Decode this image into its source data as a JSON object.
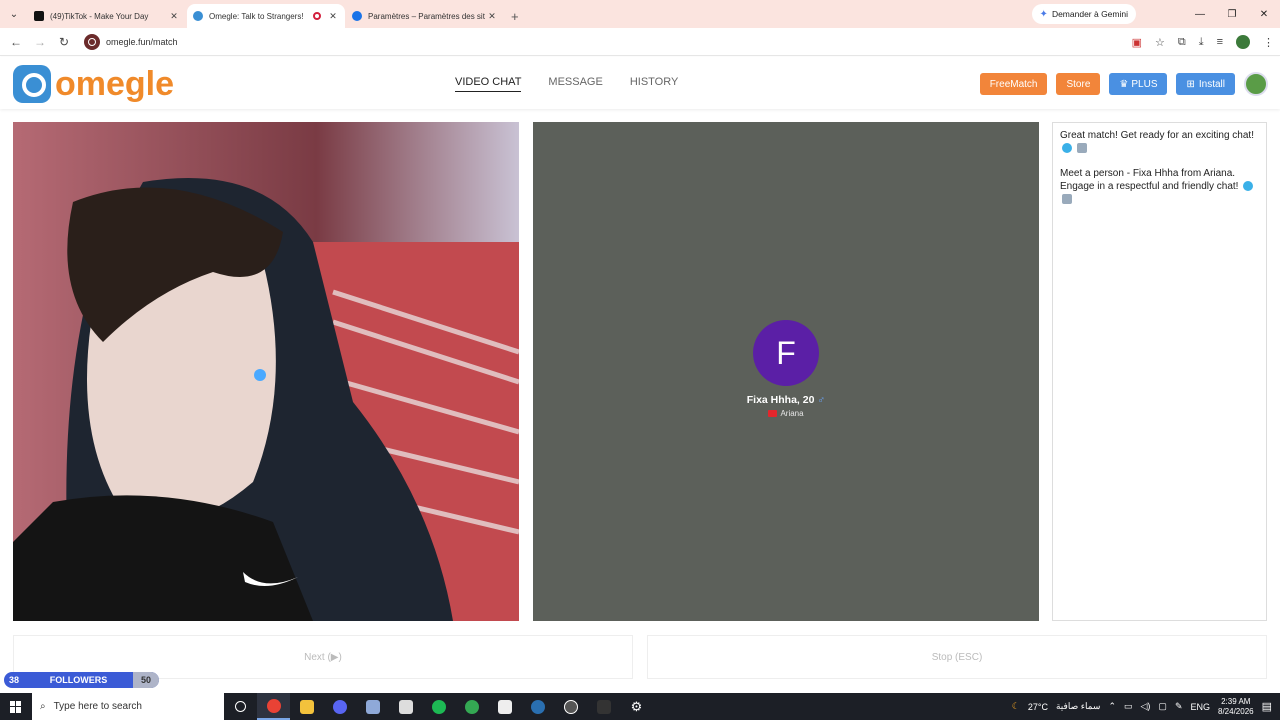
{
  "browser": {
    "tabs": [
      {
        "title": "(49)TikTok - Make Your Day",
        "active": false
      },
      {
        "title": "Omegle: Talk to Strangers!",
        "active": true
      },
      {
        "title": "Paramètres – Paramètres des sit",
        "active": false
      }
    ],
    "gemini_label": "Demander à Gemini",
    "url": "omegle.fun/match"
  },
  "site": {
    "logo_text": "omegle",
    "nav": [
      {
        "label": "VIDEO CHAT",
        "current": true
      },
      {
        "label": "MESSAGE",
        "current": false
      },
      {
        "label": "HISTORY",
        "current": false
      }
    ],
    "buttons": {
      "freematch": "FreeMatch",
      "store": "Store",
      "plus": "PLUS",
      "install": "Install"
    },
    "colors": {
      "orange": "#f2853a",
      "blue": "#4a90e2",
      "avatar_purple": "#5b1fa6"
    }
  },
  "remote": {
    "initial": "F",
    "name": "Fixa Hhha, 20",
    "location": "Ariana"
  },
  "chat": {
    "messages": [
      "Great match! Get ready for an exciting chat!",
      "Meet a person - Fixa Hhha from Ariana. Engage in a respectful and friendly chat!"
    ]
  },
  "controls": {
    "next": "Next (▶)",
    "stop": "Stop (ESC)"
  },
  "followers_widget": {
    "count": "38",
    "label": "FOLLOWERS",
    "goal": "50"
  },
  "taskbar": {
    "search_placeholder": "Type here to search",
    "weather": "27°C",
    "weather_text": "سماء صافية",
    "lang": "ENG",
    "time": "2:39 AM",
    "date": "8/24/2026"
  }
}
